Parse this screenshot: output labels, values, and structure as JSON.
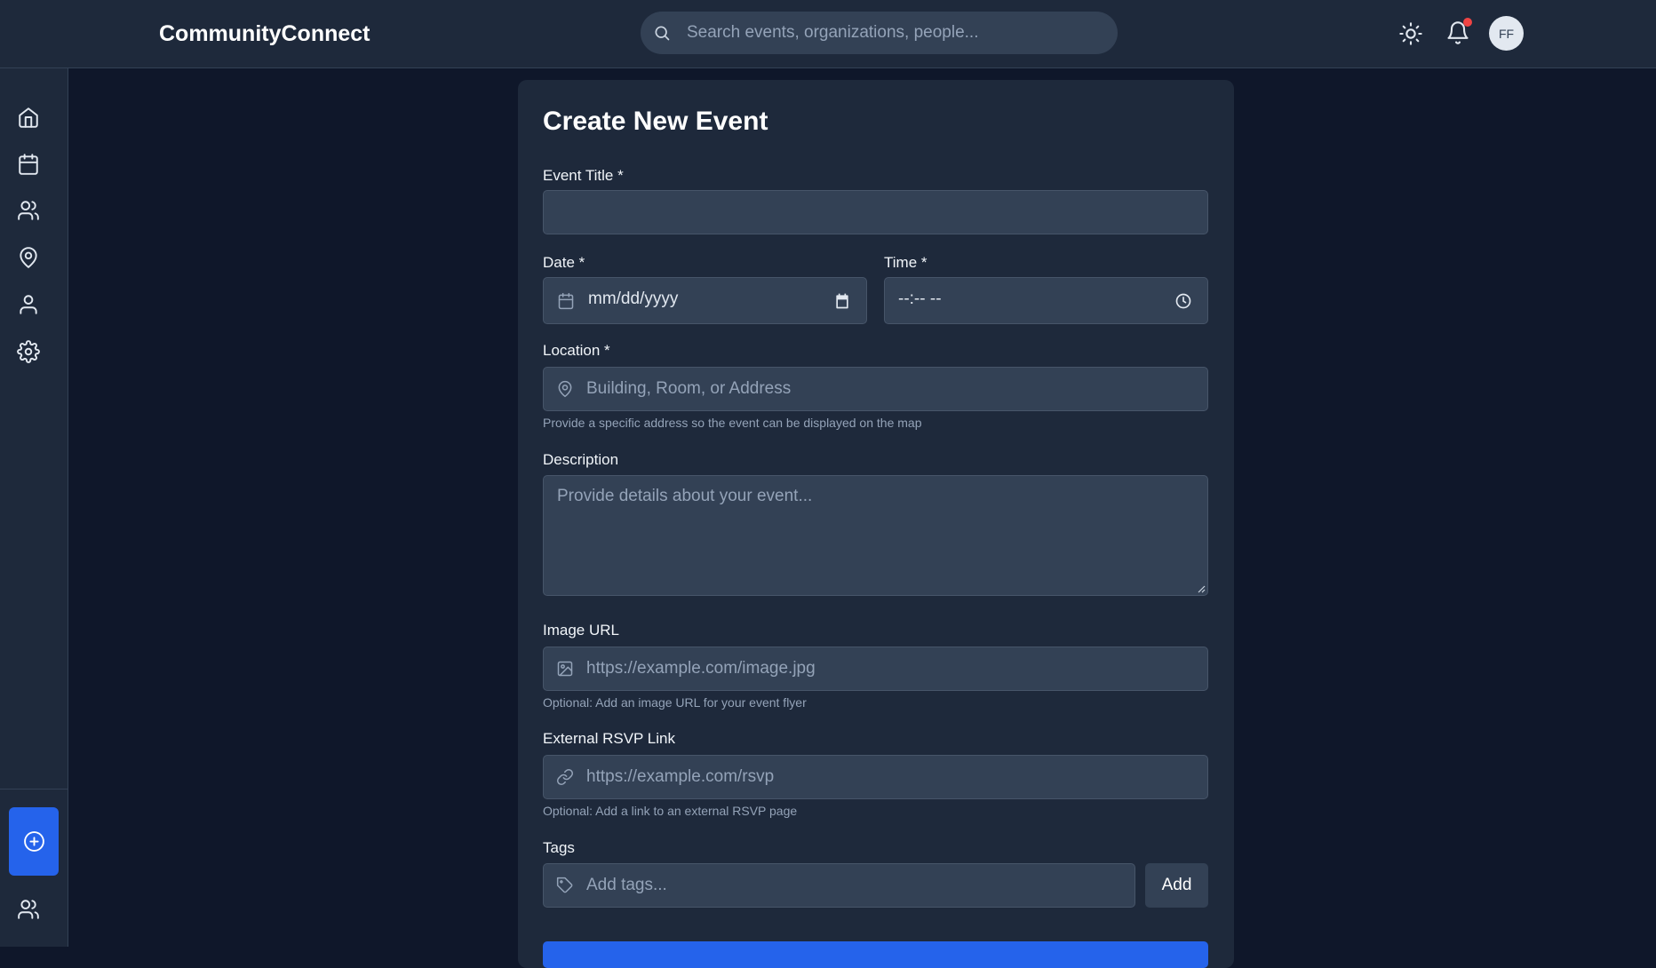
{
  "header": {
    "brand": "CommunityConnect",
    "search_placeholder": "Search events, organizations, people...",
    "avatar_initials": "FF",
    "notification_dot_color": "#ef4444"
  },
  "sidebar": {
    "items": [
      {
        "icon": "home-icon"
      },
      {
        "icon": "calendar-icon"
      },
      {
        "icon": "users-icon"
      },
      {
        "icon": "map-pin-icon"
      },
      {
        "icon": "user-icon"
      },
      {
        "icon": "gear-icon"
      }
    ],
    "create_icon": "plus-circle-icon",
    "bottom_icon": "users-icon",
    "accent_color": "#2563eb"
  },
  "form": {
    "title": "Create New Event",
    "event_title": {
      "label": "Event Title *",
      "value": ""
    },
    "date": {
      "label": "Date *",
      "value": "mm/dd/yyyy"
    },
    "time": {
      "label": "Time *",
      "value": "--:-- --"
    },
    "location": {
      "label": "Location *",
      "placeholder": "Building, Room, or Address",
      "hint": "Provide a specific address so the event can be displayed on the map"
    },
    "description": {
      "label": "Description",
      "placeholder": "Provide details about your event..."
    },
    "image_url": {
      "label": "Image URL",
      "placeholder": "https://example.com/image.jpg",
      "hint": "Optional: Add an image URL for your event flyer"
    },
    "rsvp": {
      "label": "External RSVP Link",
      "placeholder": "https://example.com/rsvp",
      "hint": "Optional: Add a link to an external RSVP page"
    },
    "tags": {
      "label": "Tags",
      "placeholder": "Add tags...",
      "add_label": "Add"
    }
  }
}
